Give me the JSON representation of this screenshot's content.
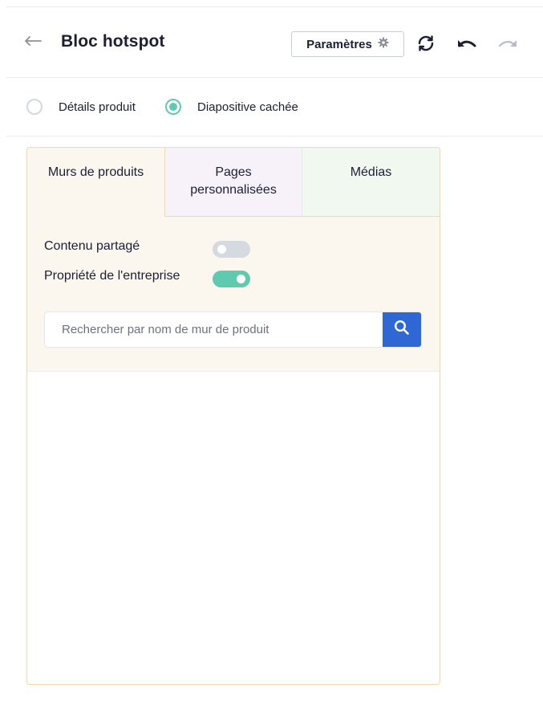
{
  "header": {
    "title": "Bloc hotspot",
    "back_icon": "arrow-left-icon",
    "settings_label": "Paramètres",
    "settings_icon": "gear-icon",
    "tools": [
      "sync-icon",
      "undo-icon",
      "redo-icon"
    ]
  },
  "view_mode": {
    "options": [
      {
        "label": "Détails produit",
        "checked": false
      },
      {
        "label": "Diapositive cachée",
        "checked": true
      }
    ]
  },
  "tabs": [
    {
      "label": "Murs de produits",
      "active": true
    },
    {
      "label": "Pages personnalisées",
      "active": false
    },
    {
      "label": "Médias",
      "active": false
    }
  ],
  "filters": {
    "shared_content": {
      "label": "Contenu partagé",
      "on": false
    },
    "company_owned": {
      "label": "Propriété de l'entreprise",
      "on": true
    }
  },
  "search": {
    "placeholder": "Rechercher par nom de mur de produit",
    "value": "",
    "button_icon": "search-icon"
  },
  "colors": {
    "accent_green": "#5ecbb0",
    "search_blue": "#2f67d4",
    "panel_border": "#f6d9a5",
    "tab_bg_products": "#fbf6ee",
    "tab_bg_pages": "#f7f1f9",
    "tab_bg_media": "#f1f8f0"
  }
}
